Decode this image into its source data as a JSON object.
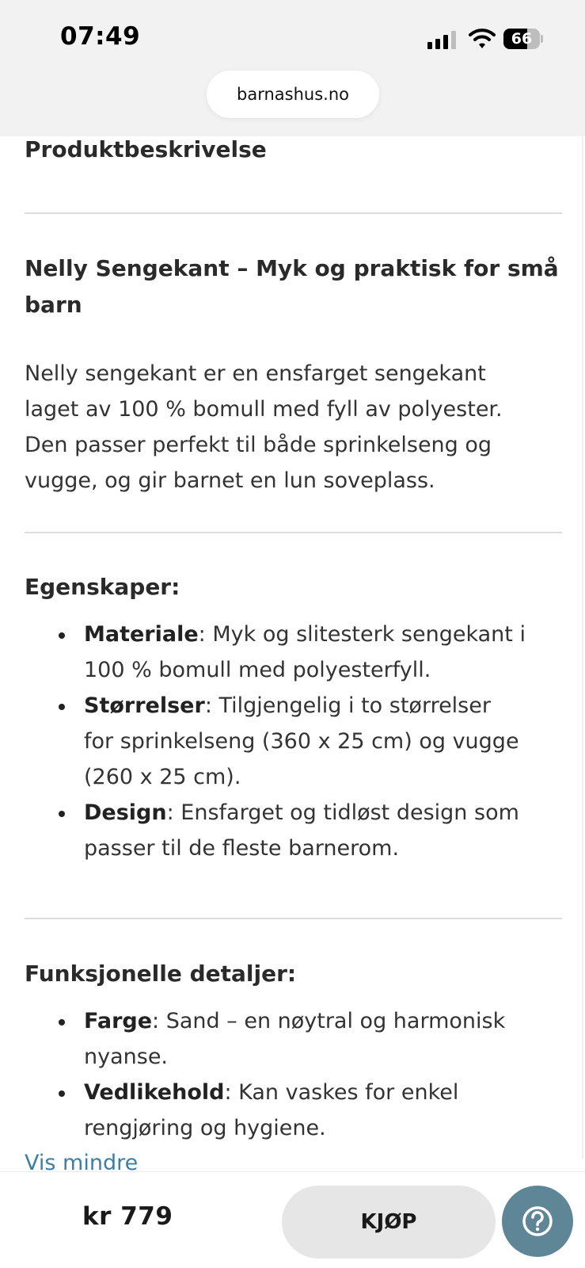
{
  "status": {
    "time": "07:49",
    "battery_percent": "66",
    "battery_level": 0.66
  },
  "browser": {
    "url": "barnashus.no"
  },
  "product": {
    "section_title": "Produktbeskrivelse",
    "heading_line1": "Nelly Sengekant – Myk og praktisk for små",
    "heading_line2": "barn",
    "description_lines": [
      "Nelly sengekant er en ensfarget sengekant",
      "laget av 100 % bomull med fyll av polyester.",
      "Den passer perfekt til både sprinkelseng og",
      "vugge, og gir barnet en lun soveplass."
    ],
    "properties": {
      "title": "Egenskaper:",
      "items": [
        {
          "term": "Materiale",
          "line1_rest": ": Myk og slitesterk sengekant i",
          "line2": "100 % bomull med polyesterfyll."
        },
        {
          "term": "Størrelser",
          "line1_rest": ": Tilgjengelig i to størrelser",
          "line2": "for sprinkelseng (360 x 25 cm) og vugge",
          "line3": "(260 x 25 cm)."
        },
        {
          "term": "Design",
          "line1_rest": ": Ensfarget og tidløst design som",
          "line2": "passer til de fleste barnerom."
        }
      ]
    },
    "functional": {
      "title": "Funksjonelle detaljer:",
      "items": [
        {
          "term": "Farge",
          "line1_rest": ": Sand – en nøytral og harmonisk",
          "line2": "nyanse."
        },
        {
          "term": "Vedlikehold",
          "line1_rest": ": Kan vaskes for enkel",
          "line2": "rengjøring og hygiene."
        }
      ]
    },
    "show_less": "Vis mindre"
  },
  "purchase": {
    "price": "kr 779",
    "buy_label": "KJØP",
    "help_icon": "question-circle-icon"
  },
  "colors": {
    "link": "#3a7fa8",
    "help_button": "#5f8697",
    "buy_button": "#e6e6e6"
  }
}
